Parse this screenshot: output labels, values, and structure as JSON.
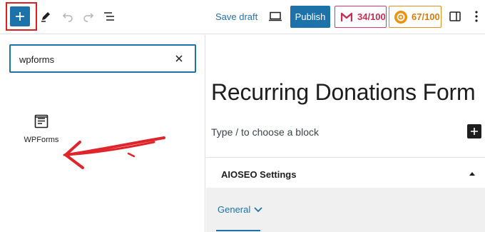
{
  "toolbar": {
    "save_draft": "Save draft",
    "publish": "Publish",
    "seo_score_1": "34/100",
    "seo_score_2": "67/100"
  },
  "inserter": {
    "search_value": "wpforms",
    "block_label": "WPForms"
  },
  "editor": {
    "post_title": "Recurring Donations Form",
    "block_placeholder": "Type / to choose a block"
  },
  "aioseo": {
    "title": "AIOSEO Settings",
    "tab_general": "General"
  },
  "colors": {
    "accent": "#1d72aa",
    "highlight": "#e02020",
    "score_red": "#c62e55",
    "score_orange": "#d97d0e"
  },
  "icons": [
    "plus-icon",
    "pencil-icon",
    "undo-icon",
    "redo-icon",
    "list-view-icon",
    "desktop-preview-icon",
    "sidebar-icon",
    "more-vertical-icon",
    "close-icon",
    "wpforms-icon",
    "chevron-up-icon",
    "chevron-down-icon"
  ]
}
